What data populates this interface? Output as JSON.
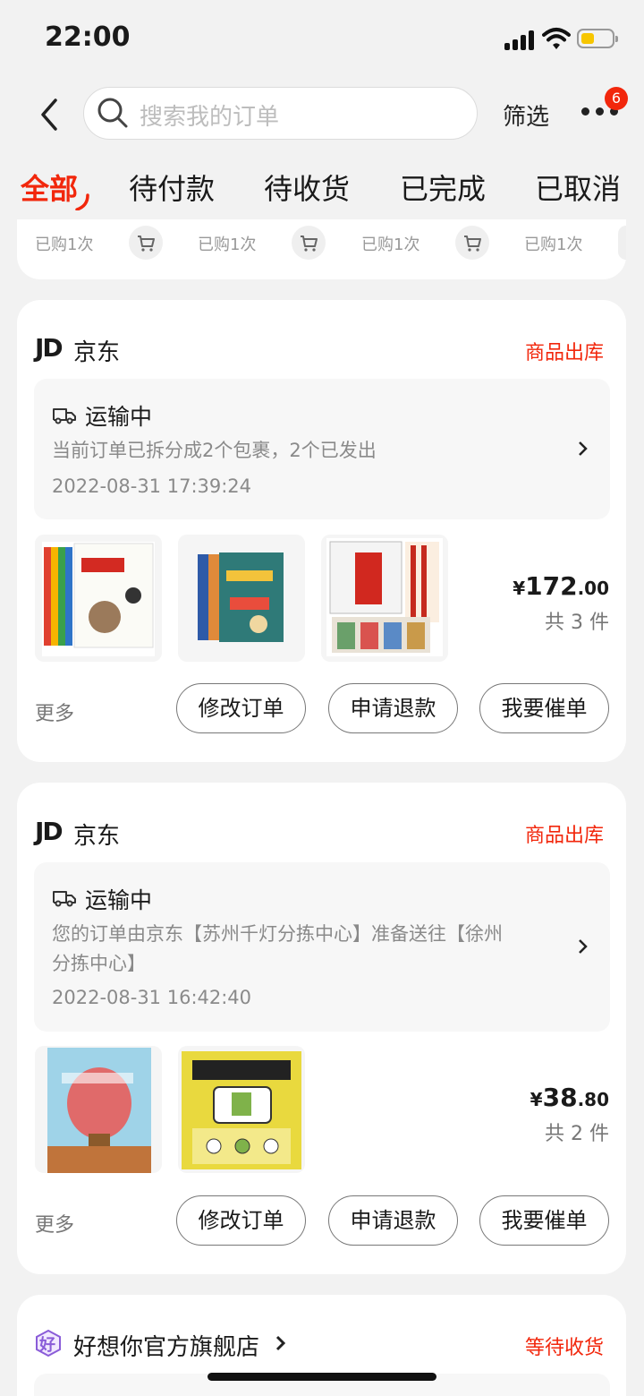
{
  "status_bar": {
    "time": "22:00"
  },
  "header": {
    "search_placeholder": "搜索我的订单",
    "filter_label": "筛选",
    "more_badge": "6"
  },
  "tabs": [
    {
      "label": "全部",
      "active": true
    },
    {
      "label": "待付款",
      "active": false
    },
    {
      "label": "待收货",
      "active": false
    },
    {
      "label": "已完成",
      "active": false
    },
    {
      "label": "已取消",
      "active": false
    }
  ],
  "recent": {
    "items": [
      {
        "label": "已购1次"
      },
      {
        "label": "已购1次"
      },
      {
        "label": "已购1次"
      },
      {
        "label": "已购1次"
      }
    ]
  },
  "orders": [
    {
      "shop_logo": "JD",
      "shop_name": "京东",
      "status": "商品出库",
      "ship_title": "运输中",
      "ship_desc": "当前订单已拆分成2个包裹，2个已发出",
      "ship_time": "2022-08-31 17:39:24",
      "price_symbol": "¥",
      "price_int": "172",
      "price_dec": ".00",
      "qty": "共 3 件",
      "more": "更多",
      "buttons": [
        "修改订单",
        "申请退款",
        "我要催单"
      ]
    },
    {
      "shop_logo": "JD",
      "shop_name": "京东",
      "status": "商品出库",
      "ship_title": "运输中",
      "ship_desc_line1": "您的订单由京东【苏州千灯分拣中心】准备送往【徐州",
      "ship_desc_line2": "分拣中心】",
      "ship_time": "2022-08-31 16:42:40",
      "price_symbol": "¥",
      "price_int": "38",
      "price_dec": ".80",
      "qty": "共 2 件",
      "more": "更多",
      "buttons": [
        "修改订单",
        "申请退款",
        "我要催单"
      ]
    },
    {
      "shop_logo": "好",
      "shop_name": "好想你官方旗舰店",
      "status": "等待收货"
    }
  ],
  "colors": {
    "accent": "#f2270c",
    "background": "#f2f2f2"
  }
}
